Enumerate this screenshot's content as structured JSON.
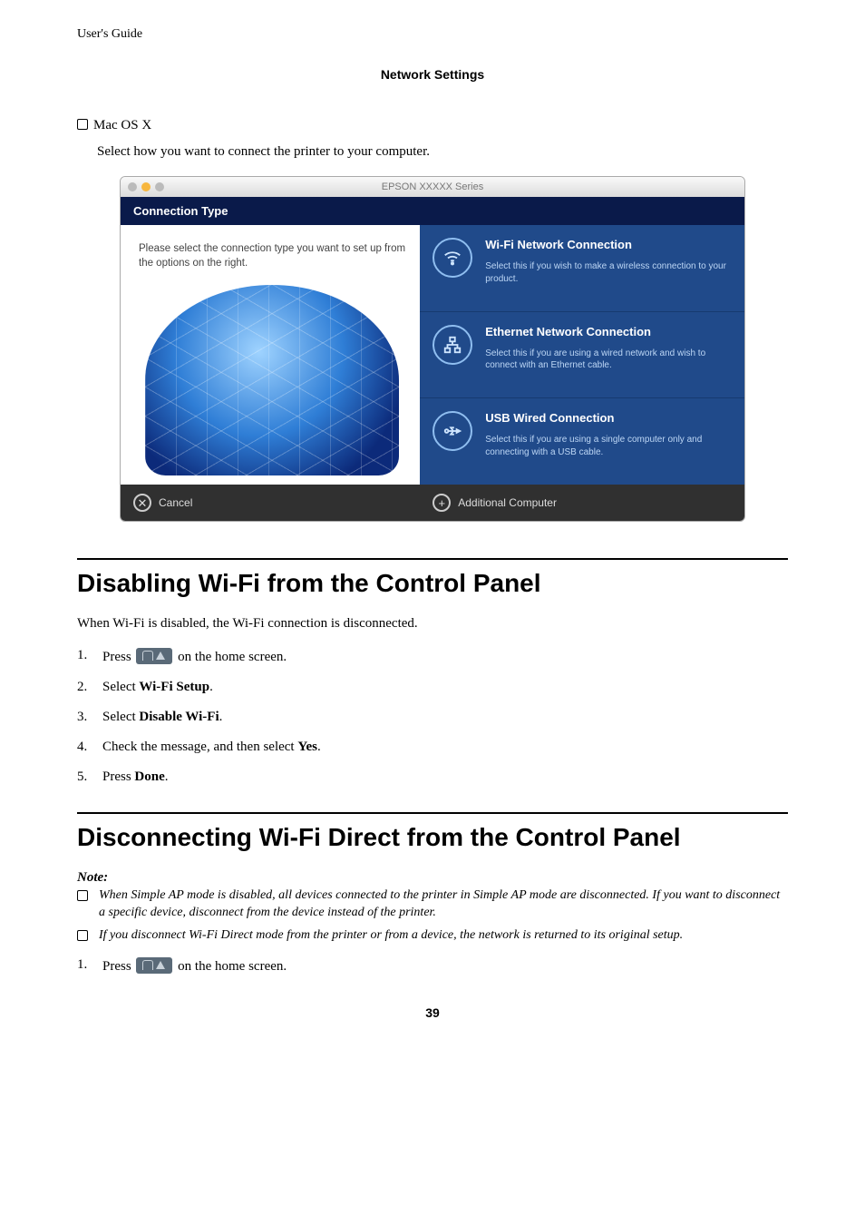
{
  "header": {
    "guide_label": "User's Guide",
    "section_title": "Network Settings"
  },
  "mac_block": {
    "os_label": "Mac OS X",
    "instruction": "Select how you want to connect the printer to your computer."
  },
  "screenshot": {
    "window_title": "EPSON XXXXX Series",
    "panel_title": "Connection Type",
    "left_text": "Please select the connection type you want to set up from the options on the right.",
    "options": [
      {
        "title": "Wi-Fi Network Connection",
        "desc": "Select this if you wish to make a wireless connection to your product."
      },
      {
        "title": "Ethernet Network Connection",
        "desc": "Select this if you are using a wired network and wish to connect with an Ethernet cable."
      },
      {
        "title": "USB Wired Connection",
        "desc": "Select this if you are using a single computer only and connecting with a USB cable."
      }
    ],
    "footer": {
      "cancel": "Cancel",
      "additional": "Additional Computer"
    }
  },
  "section1": {
    "heading": "Disabling Wi-Fi from the Control Panel",
    "intro": "When Wi-Fi is disabled, the Wi-Fi connection is disconnected.",
    "steps": {
      "s1a": "Press ",
      "s1b": " on the home screen.",
      "s2a": "Select ",
      "s2b": "Wi-Fi Setup",
      "s2c": ".",
      "s3a": "Select ",
      "s3b": "Disable Wi-Fi",
      "s3c": ".",
      "s4a": "Check the message, and then select ",
      "s4b": "Yes",
      "s4c": ".",
      "s5a": "Press ",
      "s5b": "Done",
      "s5c": "."
    }
  },
  "section2": {
    "heading": "Disconnecting Wi-Fi Direct from the Control Panel",
    "note_label": "Note:",
    "notes": [
      "When Simple AP mode is disabled, all devices connected to the printer in Simple AP mode are disconnected. If you want to disconnect a specific device, disconnect from the device instead of the printer.",
      "If you disconnect Wi-Fi Direct mode from the printer or from a device, the network is returned to its original setup."
    ],
    "step1a": "Press ",
    "step1b": " on the home screen."
  },
  "page_number": "39"
}
